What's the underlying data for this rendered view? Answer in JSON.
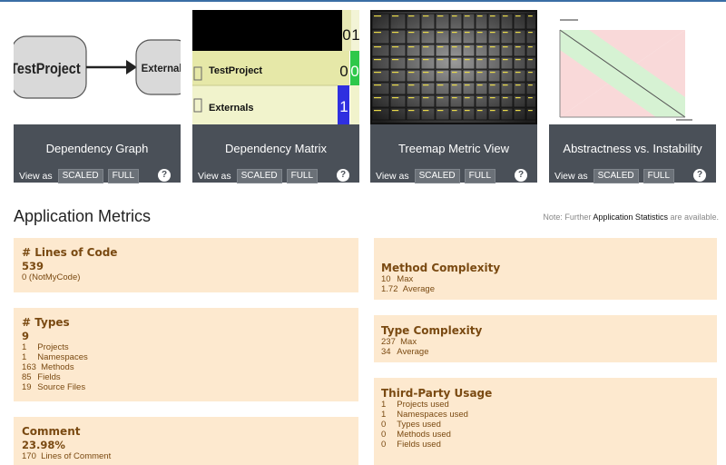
{
  "thumbnails": [
    {
      "title": "Dependency Graph",
      "view_as": "View as",
      "scaled": "SCALED",
      "full": "FULL",
      "help": "?",
      "graph": {
        "node_a": "TestProject",
        "node_b": "Externals"
      }
    },
    {
      "title": "Dependency Matrix",
      "view_as": "View as",
      "scaled": "SCALED",
      "full": "FULL",
      "help": "?",
      "matrix": {
        "rows": [
          "TestProject",
          "Externals"
        ],
        "col_headers": [
          "0",
          "1"
        ],
        "cells": [
          [
            "0",
            "0"
          ],
          [
            "",
            "1"
          ]
        ]
      }
    },
    {
      "title": "Treemap Metric View",
      "view_as": "View as",
      "scaled": "SCALED",
      "full": "FULL",
      "help": "?"
    },
    {
      "title": "Abstractness vs. Instability",
      "view_as": "View as",
      "scaled": "SCALED",
      "full": "FULL",
      "help": "?"
    }
  ],
  "section_title": "Application Metrics",
  "note": {
    "prefix": "Note: Further ",
    "link": "Application Statistics",
    "suffix": " are available."
  },
  "metrics": {
    "lines_of_code": {
      "title": "# Lines of Code",
      "value": "539",
      "lines": [
        {
          "text": "0 (NotMyCode)"
        }
      ]
    },
    "types": {
      "title": "# Types",
      "value": "9",
      "lines": [
        {
          "n": "1",
          "label": "Projects"
        },
        {
          "n": "1",
          "label": "Namespaces"
        },
        {
          "n": "163",
          "label": "Methods"
        },
        {
          "n": "85",
          "label": "Fields"
        },
        {
          "n": "19",
          "label": "Source Files"
        }
      ]
    },
    "comment": {
      "title": "Comment",
      "value": "23.98%",
      "lines": [
        {
          "n": "170",
          "label": "Lines of Comment"
        }
      ]
    },
    "method_complexity": {
      "title": "Method Complexity",
      "lines": [
        {
          "n": "10",
          "label": "Max"
        },
        {
          "n": "1.72",
          "label": "Average"
        }
      ]
    },
    "type_complexity": {
      "title": "Type Complexity",
      "lines": [
        {
          "n": "237",
          "label": "Max"
        },
        {
          "n": "34",
          "label": "Average"
        }
      ]
    },
    "third_party": {
      "title": "Third-Party Usage",
      "lines": [
        {
          "n": "1",
          "label": "Projects used"
        },
        {
          "n": "1",
          "label": "Namespaces used"
        },
        {
          "n": "0",
          "label": "Types used"
        },
        {
          "n": "0",
          "label": "Methods used"
        },
        {
          "n": "0",
          "label": "Fields used"
        }
      ]
    }
  }
}
